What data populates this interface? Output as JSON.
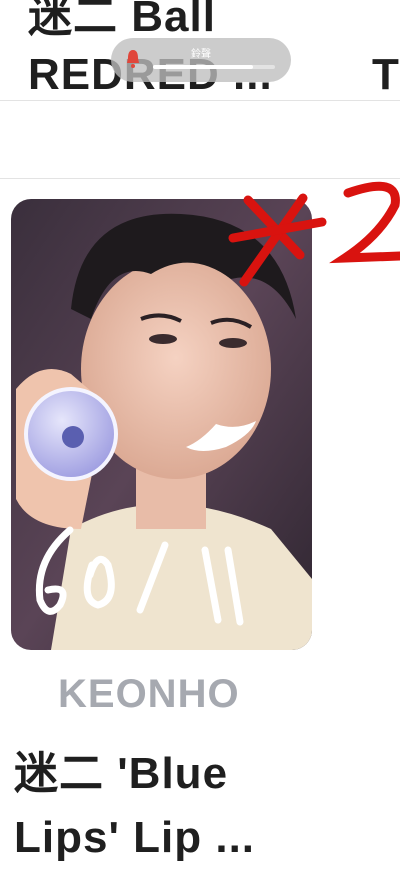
{
  "listing_above": {
    "title": "迷二 Ball\nREDRED ..."
  },
  "neighbor_card": {
    "title_fragment": "T"
  },
  "ringer_hud": {
    "label": "鈴聲",
    "volume_fraction": 0.82,
    "icon": "bell-icon",
    "icon_color": "#e0463a"
  },
  "product": {
    "photo": "photocard-image",
    "member": "KEONHO",
    "title": "迷二 'Blue\nLips' Lip ..."
  },
  "handwriting": {
    "mark": "*2",
    "price": "60/1",
    "mark_color": "#d9130f",
    "price_color": "#ffffff"
  }
}
